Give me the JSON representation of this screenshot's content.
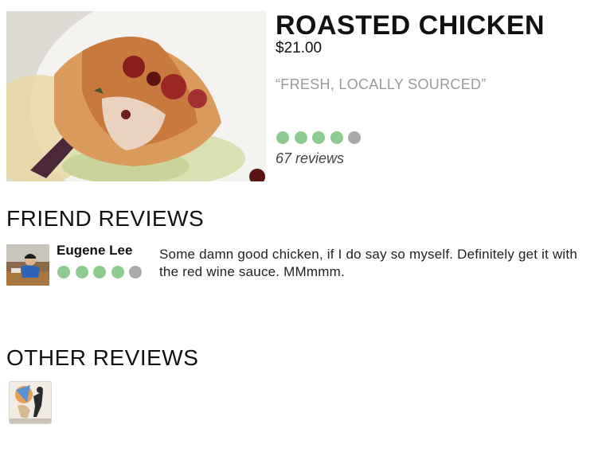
{
  "dish": {
    "name": "ROASTED CHICKEN",
    "price": "$21.00",
    "tagline": "“FRESH, LOCALLY SOURCED”",
    "rating": 4,
    "rating_max": 5,
    "review_count": "67 reviews"
  },
  "friend_reviews": {
    "heading": "FRIEND REVIEWS",
    "items": [
      {
        "name": "Eugene Lee",
        "rating": 4,
        "rating_max": 5,
        "text": "Some damn good chicken, if I do say so myself. Definitely get it with the red wine sauce. MMmmm."
      }
    ]
  },
  "other_reviews": {
    "heading": "OTHER REVIEWS"
  },
  "colors": {
    "rating_on": "#8ecb8e",
    "rating_off": "#a9a9a9",
    "tagline": "#9a9a9a"
  }
}
